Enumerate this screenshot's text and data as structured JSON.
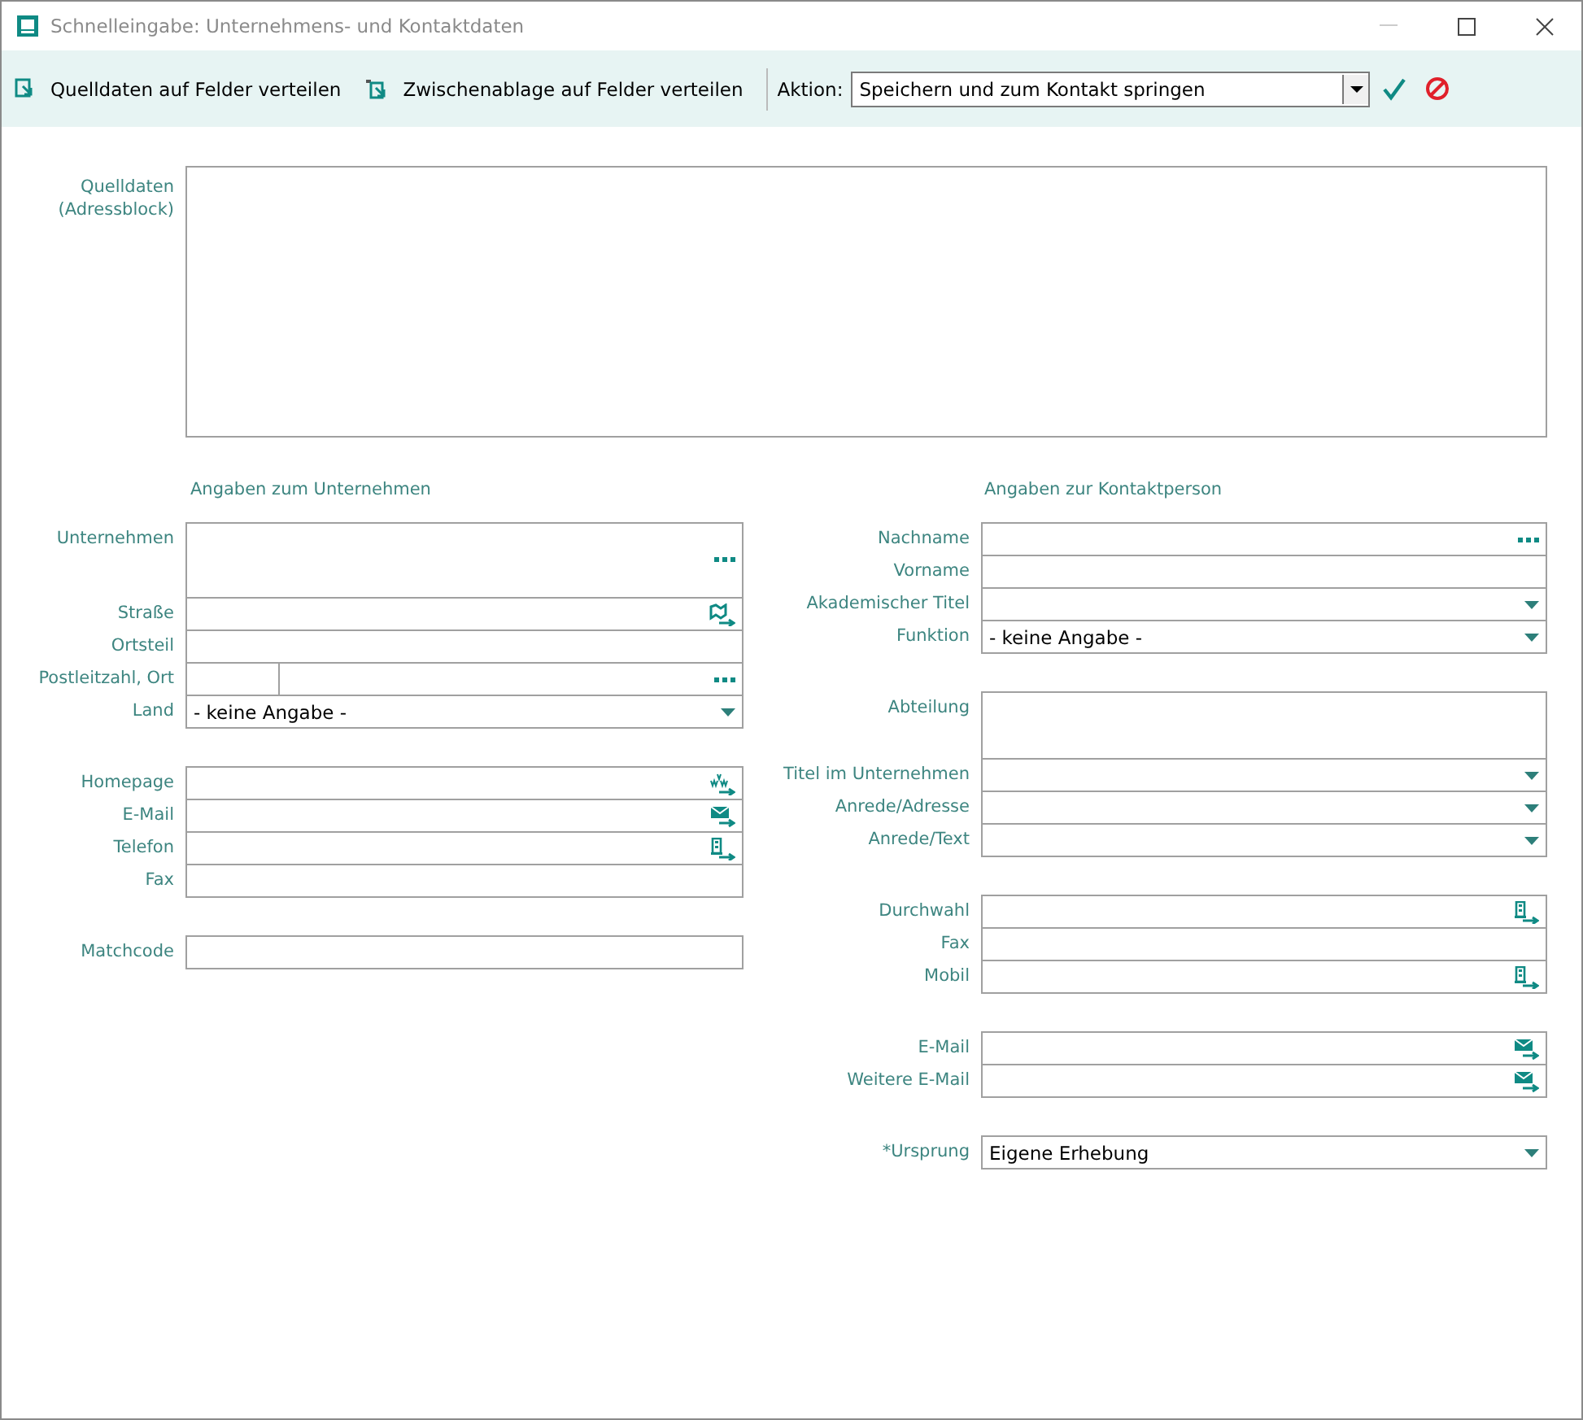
{
  "window": {
    "title": "Schnelleingabe: Unternehmens- und Kontaktdaten"
  },
  "toolbar": {
    "buttons": [
      {
        "label": "Quelldaten auf Felder verteilen",
        "kind": "source"
      },
      {
        "label": "Zwischenablage auf Felder verteilen",
        "kind": "clipboard"
      }
    ],
    "action_label": "Aktion:",
    "action_value": "Speichern und zum Kontakt springen"
  },
  "source": {
    "label_lines": [
      "Quelldaten",
      "(Adressblock)"
    ]
  },
  "sections": [
    {
      "heading": "Angaben zum Unternehmen",
      "groups": [
        [
          {
            "label": "Unternehmen",
            "kind": "multilookup"
          },
          {
            "label": "Straße",
            "kind": "address"
          },
          {
            "label": "Ortsteil",
            "kind": "text"
          },
          {
            "label": "Postleitzahl, Ort",
            "kind": "split"
          },
          {
            "label": "Land",
            "kind": "combo",
            "value": "- keine Angabe -"
          }
        ],
        [
          {
            "label": "Homepage",
            "kind": "web"
          },
          {
            "label": "E-Mail",
            "kind": "mail"
          },
          {
            "label": "Telefon",
            "kind": "phone"
          },
          {
            "label": "Fax",
            "kind": "text"
          }
        ],
        [
          {
            "label": "Matchcode",
            "kind": "text"
          }
        ]
      ]
    },
    {
      "heading": "Angaben zur Kontaktperson",
      "groups": [
        [
          {
            "label": "Nachname",
            "kind": "lookup"
          },
          {
            "label": "Vorname",
            "kind": "text"
          },
          {
            "label": "Akademischer Titel",
            "kind": "combo"
          },
          {
            "label": "Funktion",
            "kind": "combo",
            "value": "- keine Angabe -"
          }
        ],
        [
          {
            "label": "Abteilung",
            "kind": "multiline"
          },
          {
            "label": "Titel im Unternehmen",
            "kind": "combo"
          },
          {
            "label": "Anrede/Adresse",
            "kind": "combo"
          },
          {
            "label": "Anrede/Text",
            "kind": "combo"
          }
        ],
        [
          {
            "label": "Durchwahl",
            "kind": "phone"
          },
          {
            "label": "Fax",
            "kind": "text"
          },
          {
            "label": "Mobil",
            "kind": "phone"
          }
        ],
        [
          {
            "label": "E-Mail",
            "kind": "mail"
          },
          {
            "label": "Weitere E-Mail",
            "kind": "mail"
          }
        ],
        [
          {
            "label": "*Ursprung",
            "kind": "combo",
            "value": "Eigene Erhebung"
          }
        ]
      ]
    }
  ]
}
